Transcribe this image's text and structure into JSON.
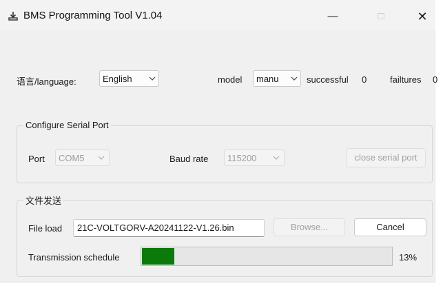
{
  "window": {
    "title": "BMS Programming Tool V1.04",
    "controls": {
      "minimize": "—",
      "maximize": "□",
      "close": "✕"
    }
  },
  "top_row": {
    "language_label": "语言/language:",
    "language_value": "English",
    "model_label": "model",
    "model_value": "manu",
    "successful_label": "successful",
    "successful_count": "0",
    "failures_label": "failtures",
    "failures_count": "0"
  },
  "serial_group": {
    "title": "Configure Serial Port",
    "port_label": "Port",
    "port_value": "COM5",
    "baud_label": "Baud rate",
    "baud_value": "115200",
    "close_button": "close serial port"
  },
  "file_group": {
    "title": "文件发送",
    "file_load_label": "File load",
    "file_value": "21C-VOLTGORV-A20241122-V1.26.bin",
    "browse_button": "Browse...",
    "cancel_button": "Cancel",
    "progress_label": "Transmission schedule",
    "progress_percent_text": "13%",
    "progress_fraction": 0.13
  },
  "colors": {
    "progress_fill": "#0b7a0b",
    "window_bg": "#f0f0f0"
  },
  "icons": {
    "app": "download-tray-icon",
    "dropdown": "chevron-down-icon"
  }
}
